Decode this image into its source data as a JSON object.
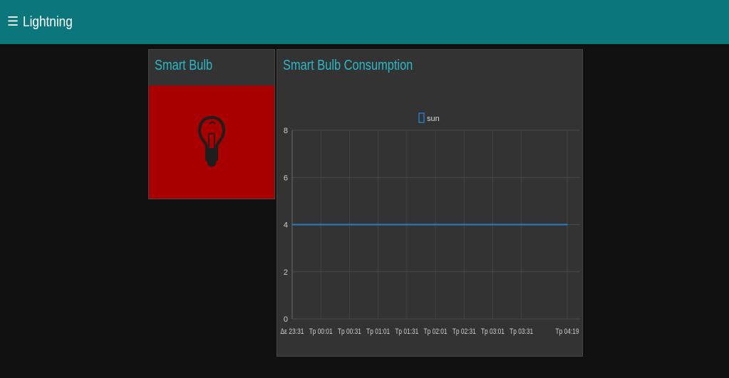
{
  "header": {
    "menu_icon": "☰",
    "title": "Lightning"
  },
  "bulb_card": {
    "title": "Smart Bulb",
    "icon": "lightbulb-icon",
    "tile_color": "#a80000",
    "icon_color": "#1e1e1e"
  },
  "chart_card": {
    "title": "Smart Bulb Consumption"
  },
  "colors": {
    "header_bg": "#0b777d",
    "page_bg": "#111111",
    "card_bg": "#333333",
    "accent": "#2ab9c9",
    "series": "#2b7bc5"
  },
  "chart_data": {
    "type": "line",
    "title": "",
    "xlabel": "",
    "ylabel": "",
    "ylim": [
      0,
      8
    ],
    "yticks": [
      0,
      2,
      4,
      6,
      8
    ],
    "x": [
      "Δε 23:31",
      "Tp 00:01",
      "Tp 00:31",
      "Tp 01:01",
      "Tp 01:31",
      "Tp 02:01",
      "Tp 02:31",
      "Tp 03:01",
      "Tp 03:31",
      "Tp 04:19"
    ],
    "x_minutes": [
      0,
      30,
      60,
      90,
      120,
      150,
      180,
      210,
      240,
      288
    ],
    "series": [
      {
        "name": "sun",
        "values": [
          4,
          4,
          4,
          4,
          4,
          4,
          4,
          4,
          4,
          4
        ]
      }
    ],
    "legend": "top-center",
    "grid": true
  }
}
